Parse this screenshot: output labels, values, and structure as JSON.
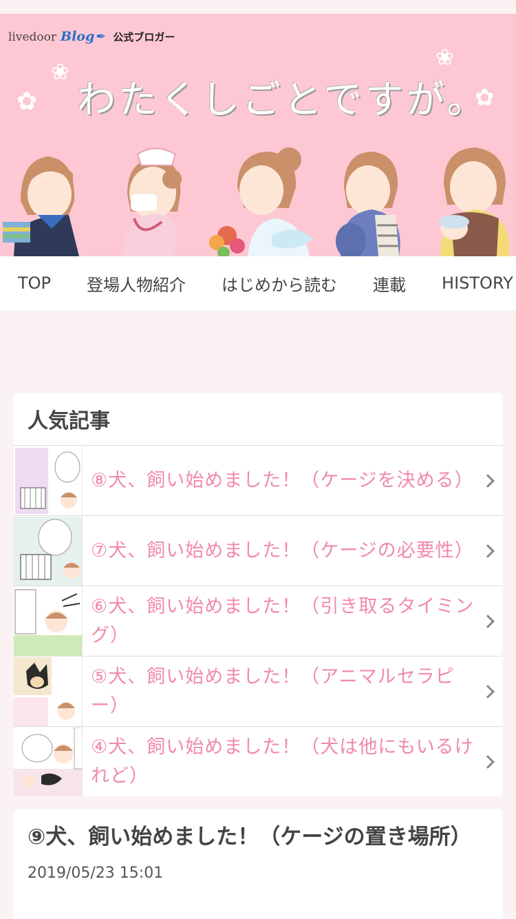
{
  "header": {
    "brand_livedoor": "livedoor",
    "brand_blog": "Blog",
    "brand_official": "公式ブロガー",
    "blog_title": "わたくしごとですが。",
    "banner_color": "#fdc8d3"
  },
  "nav": {
    "items": [
      "TOP",
      "登場人物紹介",
      "はじめから読む",
      "連載",
      "HISTORY"
    ]
  },
  "popular": {
    "title": "人気記事",
    "items": [
      {
        "title": "⑧犬、飼い始めました！（ケージを決める）"
      },
      {
        "title": "⑦犬、飼い始めました！（ケージの必要性）"
      },
      {
        "title": "⑥犬、飼い始めました！（引き取るタイミング）"
      },
      {
        "title": "⑤犬、飼い始めました！（アニマルセラピー）"
      },
      {
        "title": "④犬、飼い始めました！（犬は他にもいるけれど）"
      }
    ],
    "text_color": "#f08aa8"
  },
  "article": {
    "title": "⑨犬、飼い始めました！（ケージの置き場所）",
    "date": "2019/05/23 15:01"
  }
}
